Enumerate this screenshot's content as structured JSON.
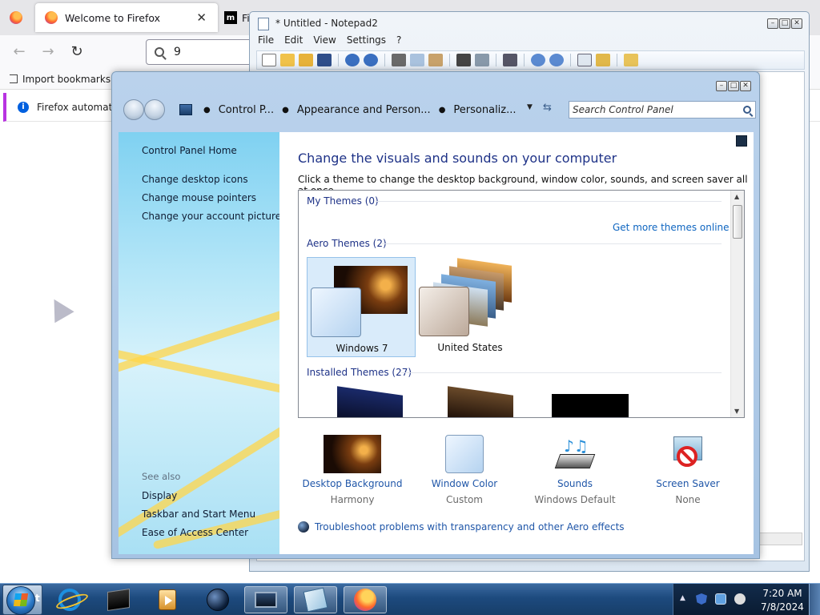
{
  "firefox": {
    "tab_active_title": "Welcome to Firefox",
    "tab_close_glyph": "✕",
    "tab_third_initial": "Fi",
    "tab_third_logo": "m",
    "back_glyph": "←",
    "forward_glyph": "→",
    "reload_glyph": "↻",
    "url_value": "9",
    "import_bookmarks": "Import bookmarks...",
    "notification": "Firefox automatica"
  },
  "notepad": {
    "title": "* Untitled - Notepad2",
    "menu": [
      "File",
      "Edit",
      "View",
      "Settings",
      "?"
    ]
  },
  "control_panel": {
    "breadcrumb": [
      "Control P...",
      "Appearance and Person...",
      "Personaliz..."
    ],
    "search_placeholder": "Search Control Panel",
    "sidebar": {
      "home": "Control Panel Home",
      "links": [
        "Change desktop icons",
        "Change mouse pointers",
        "Change your account picture"
      ],
      "see_also_label": "See also",
      "see_also": [
        "Display",
        "Taskbar and Start Menu",
        "Ease of Access Center"
      ]
    },
    "main": {
      "title": "Change the visuals and sounds on your computer",
      "subtitle": "Click a theme to change the desktop background, window color, sounds, and screen saver all at once.",
      "groups": {
        "my_themes": "My Themes (0)",
        "get_more": "Get more themes online",
        "aero_themes": "Aero Themes (2)",
        "installed_themes": "Installed Themes (27)"
      },
      "themes": [
        "Windows 7",
        "United States"
      ],
      "bottom_items": [
        {
          "name": "Desktop Background",
          "value": "Harmony"
        },
        {
          "name": "Window Color",
          "value": "Custom"
        },
        {
          "name": "Sounds",
          "value": "Windows Default"
        },
        {
          "name": "Screen Saver",
          "value": "None"
        }
      ],
      "troubleshoot": "Troubleshoot problems with transparency and other Aero effects"
    }
  },
  "taskbar": {
    "start_label": "t",
    "time": "7:20 AM",
    "date": "7/8/2024"
  },
  "colors": {
    "link_blue": "#1f56a8",
    "title_blue": "#1e3287",
    "taskbar": "#1d4a7e"
  }
}
